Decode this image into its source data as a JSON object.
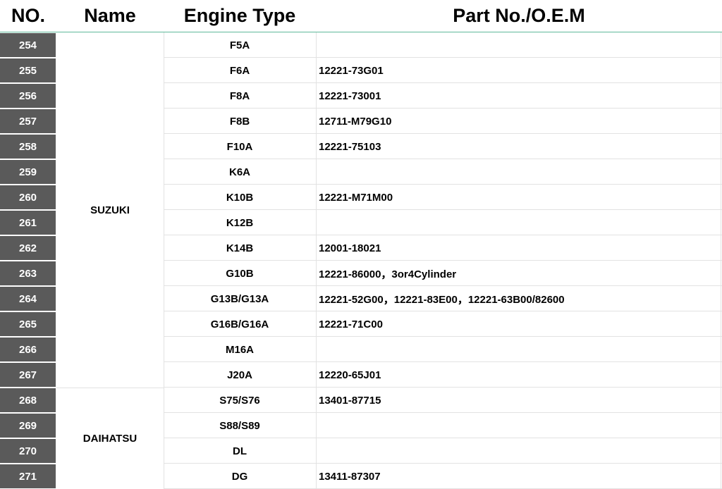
{
  "headers": {
    "no": "NO.",
    "name": "Name",
    "engine": "Engine Type",
    "part": "Part No./O.E.M"
  },
  "groups": [
    {
      "name": "SUZUKI",
      "first_row": 0,
      "row_count": 14
    },
    {
      "name": "DAIHATSU",
      "first_row": 14,
      "row_count": 4
    }
  ],
  "rows": [
    {
      "no": "254",
      "engine": "F5A",
      "part": ""
    },
    {
      "no": "255",
      "engine": "F6A",
      "part": "12221-73G01"
    },
    {
      "no": "256",
      "engine": "F8A",
      "part": "12221-73001"
    },
    {
      "no": "257",
      "engine": "F8B",
      "part": "12711-M79G10"
    },
    {
      "no": "258",
      "engine": "F10A",
      "part": "12221-75103"
    },
    {
      "no": "259",
      "engine": "K6A",
      "part": ""
    },
    {
      "no": "260",
      "engine": "K10B",
      "part": "12221-M71M00"
    },
    {
      "no": "261",
      "engine": "K12B",
      "part": ""
    },
    {
      "no": "262",
      "engine": "K14B",
      "part": "12001-18021"
    },
    {
      "no": "263",
      "engine": "G10B",
      "part": "12221-86000，3or4Cylinder"
    },
    {
      "no": "264",
      "engine": "G13B/G13A",
      "part": "12221-52G00，12221-83E00，12221-63B00/82600"
    },
    {
      "no": "265",
      "engine": "G16B/G16A",
      "part": "12221-71C00"
    },
    {
      "no": "266",
      "engine": "M16A",
      "part": ""
    },
    {
      "no": "267",
      "engine": "J20A",
      "part": "12220-65J01"
    },
    {
      "no": "268",
      "engine": "S75/S76",
      "part": "13401-87715"
    },
    {
      "no": "269",
      "engine": "S88/S89",
      "part": ""
    },
    {
      "no": "270",
      "engine": "DL",
      "part": ""
    },
    {
      "no": "271",
      "engine": "DG",
      "part": "13411-87307"
    }
  ],
  "colors": {
    "number_cell_bg": "#5a5a5a",
    "number_cell_text": "#ffffff",
    "header_rule": "#5fb99a",
    "grid_line": "#e2e2e2"
  }
}
